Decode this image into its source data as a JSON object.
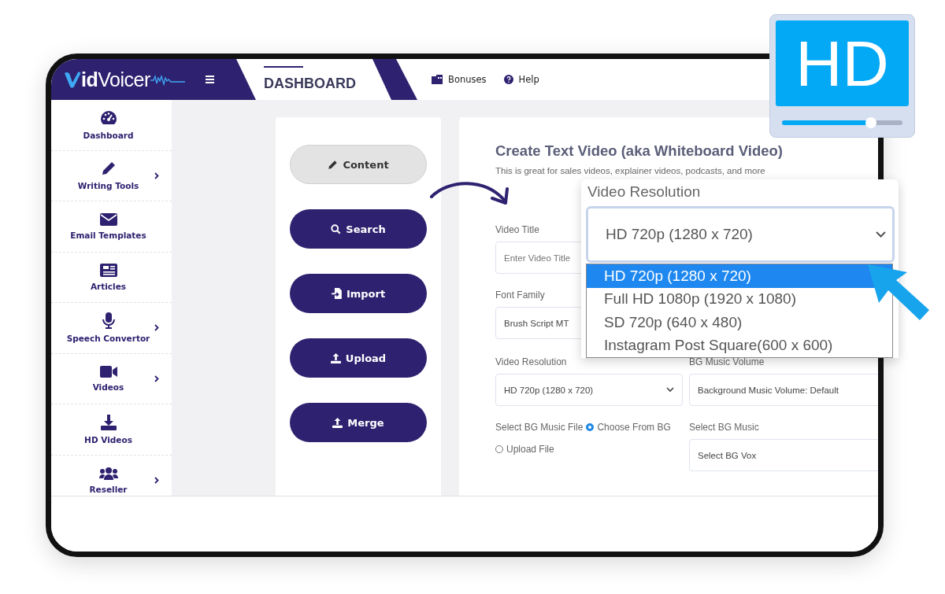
{
  "header": {
    "logo": "**id**Voicer",
    "tab": {
      "label": "DASHBOARD",
      "selected": true
    },
    "links": [
      {
        "label": "Bonuses"
      },
      {
        "label": "Help"
      }
    ]
  },
  "sidebar": {
    "items": [
      {
        "label": "Dashboard",
        "has_submenu": false
      },
      {
        "label": "Writing Tools",
        "has_submenu": true
      },
      {
        "label": "Email Templates",
        "has_submenu": false
      },
      {
        "label": "Articles",
        "has_submenu": false
      },
      {
        "label": "Speech Convertor",
        "has_submenu": true
      },
      {
        "label": "Videos",
        "has_submenu": true
      },
      {
        "label": "HD Videos",
        "has_submenu": false
      },
      {
        "label": "Reseller",
        "has_submenu": true
      }
    ]
  },
  "actions": [
    {
      "label": "Content",
      "selected": true
    },
    {
      "label": "Search",
      "selected": false
    },
    {
      "label": "Import",
      "selected": false
    },
    {
      "label": "Upload",
      "selected": false
    },
    {
      "label": "Merge",
      "selected": false
    }
  ],
  "form": {
    "title": "Create Text Video (aka Whiteboard Video)",
    "subtitle": "This is great for sales videos, explainer videos, podcasts, and more",
    "video_title": {
      "label": "Video Title",
      "placeholder": "Enter Video Title"
    },
    "font_family": {
      "label": "Font Family",
      "value": "Brush Script MT"
    },
    "video_resolution": {
      "label": "Video Resolution",
      "value": "HD 720p (1280 x 720)"
    },
    "bg_music_volume": {
      "label": "BG Music Volume",
      "value": "Background Music Volume: Default"
    },
    "bg_music_file": {
      "label": "Select BG Music File",
      "options": [
        {
          "label": "Choose From BG",
          "selected": true
        },
        {
          "label": "Upload File",
          "selected": false
        }
      ]
    },
    "bg_music": {
      "label": "Select BG Music",
      "value": "Select BG Vox"
    }
  },
  "resolution_popup": {
    "label": "Video Resolution",
    "value": "HD 720p (1280 x 720)",
    "options": [
      {
        "label": "HD 720p (1280 x 720)",
        "selected": true
      },
      {
        "label": "Full HD 1080p (1920 x 1080)",
        "selected": false
      },
      {
        "label": "SD 720p (640 x 480)",
        "selected": false
      },
      {
        "label": "Instagram Post Square(600 x 600)",
        "selected": false
      }
    ]
  },
  "hd_badge": {
    "text": "HD",
    "level": 0.74
  }
}
